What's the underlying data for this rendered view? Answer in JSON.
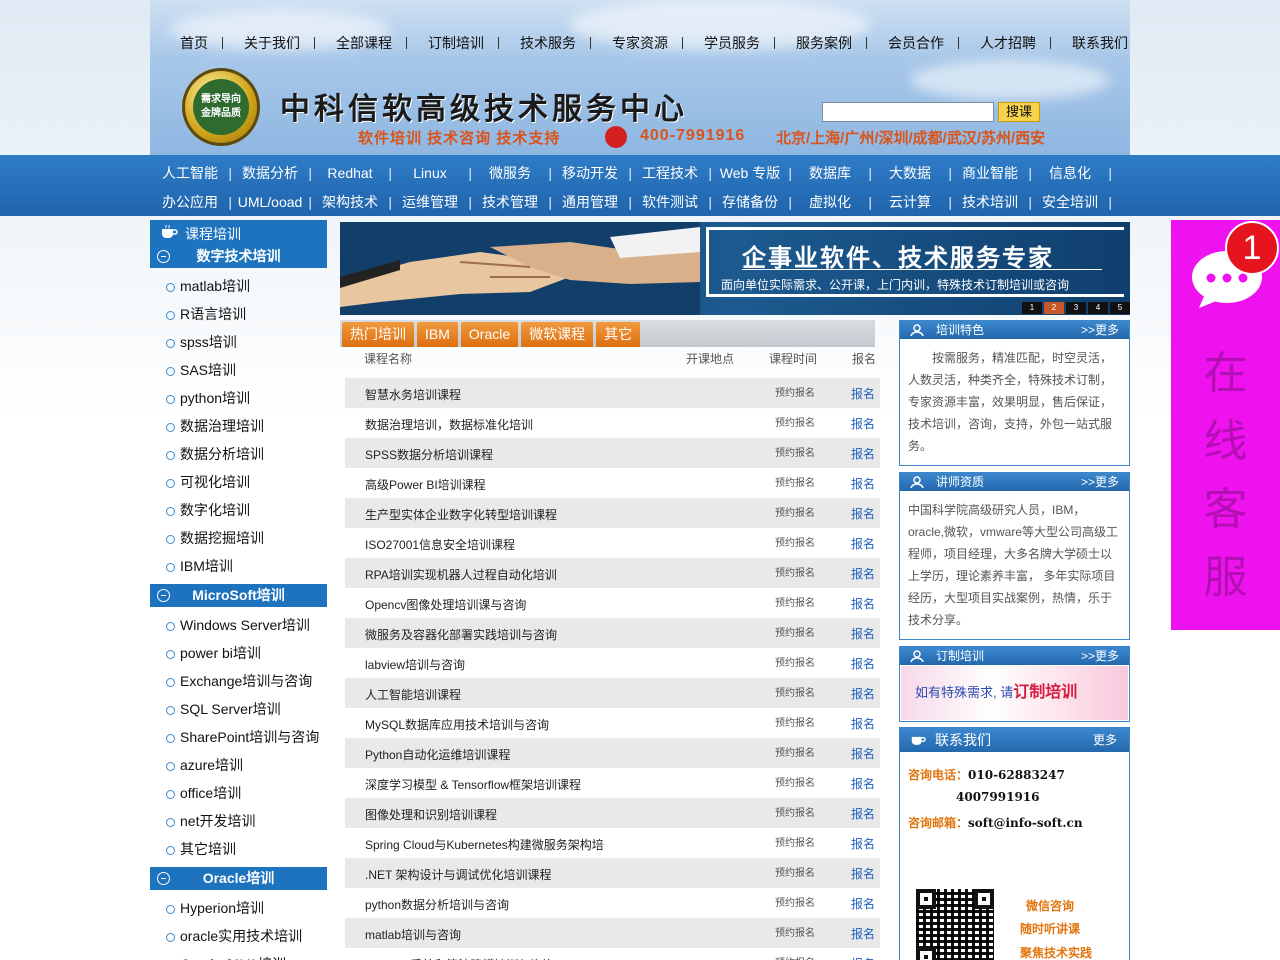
{
  "topnav": [
    "首页",
    "关于我们",
    "全部课程",
    "订制培训",
    "技术服务",
    "专家资源",
    "学员服务",
    "服务案例",
    "会员合作",
    "人才招聘",
    "联系我们"
  ],
  "header": {
    "seal_line1": "需求导向",
    "seal_line2": "金牌品质",
    "title": "中科信软高级技术服务中心",
    "slogan": "软件培训  技术咨询  技术支持",
    "phone": "400-7991916",
    "cities": "北京/上海/广州/深圳/成都/武汉/苏州/西安",
    "search_button": "搜课",
    "search_value": ""
  },
  "category_row1": [
    "人工智能",
    "数据分析",
    "Redhat",
    "Linux",
    "微服务",
    "移动开发",
    "工程技术",
    "Web 专版",
    "数据库",
    "大数据",
    "商业智能",
    "信息化"
  ],
  "category_row2": [
    "办公应用",
    "UML/ooad",
    "架构技术",
    "运维管理",
    "技术管理",
    "通用管理",
    "软件测试",
    "存储备份",
    "虚拟化",
    "云计算",
    "技术培训",
    "安全培训"
  ],
  "sidebar": {
    "header": "课程培训",
    "group1": "数字技术培训",
    "group1_items": [
      "matlab培训",
      "R语言培训",
      "spss培训",
      "SAS培训",
      "python培训",
      "数据治理培训",
      "数据分析培训",
      "可视化培训",
      "数字化培训",
      "数据挖掘培训",
      "IBM培训"
    ],
    "group2": "MicroSoft培训",
    "group2_items": [
      "Windows Server培训",
      "power bi培训",
      "Exchange培训与咨询",
      "SQL Server培训",
      "SharePoint培训与咨询",
      "azure培训",
      "office培训",
      "net开发培训",
      "其它培训"
    ],
    "group3": "Oracle培训",
    "group3_items": [
      "Hyperion培训",
      "oracle实用技术培训",
      "Oracle JAVA培训"
    ]
  },
  "banner": {
    "title": "企事业软件、技术服务专家",
    "subtitle": "面向单位实际需求、公开课，上门内训，特殊技术订制培训或咨询",
    "pages": [
      "1",
      "2",
      "3",
      "4",
      "5"
    ],
    "active_page": "2"
  },
  "tabs": [
    "热门培训",
    "IBM",
    "Oracle",
    "微软课程",
    "其它"
  ],
  "table": {
    "col_name": "课程名称",
    "col_location": "开课地点",
    "col_time": "课程时间",
    "col_signup": "报名",
    "time_text": "预约报名",
    "signup_text": "报名",
    "rows": [
      "智慧水务培训课程",
      "数据治理培训，数据标准化培训",
      "SPSS数据分析培训课程",
      "高级Power BI培训课程",
      "生产型实体企业数字化转型培训课程",
      "ISO27001信息安全培训课程",
      "RPA培训实现机器人过程自动化培训",
      "Opencv图像处理培训课与咨询",
      "微服务及容器化部署实践培训与咨询",
      "labview培训与咨询",
      "人工智能培训课程",
      "MySQL数据库应用技术培训与咨询",
      "Python自动化运维培训课程",
      "深度学习模型 & Tensorflow框架培训课程",
      "图像处理和识别培训课程",
      "Spring Cloud与Kubernetes构建微服务架构培",
      ".NET 架构设计与调试优化培训课程",
      "python数据分析培训与咨询",
      "matlab培训与咨询",
      "Simulink系统和算法建模培训与咨询"
    ]
  },
  "right": {
    "box1_title": "培训特色",
    "box1_more": ">>更多",
    "box1_text": "按需服务，精准匹配，时空灵活，人数灵活，种类齐全，特殊技术订制，专家资源丰富，效果明显，售后保证，技术培训，咨询，支持，外包一站式服务。",
    "box2_title": "讲师资质",
    "box2_more": ">>更多",
    "box2_text": "中国科学院高级研究人员，IBM，oracle,微软，vmware等大型公司高级工程师，项目经理，大多名牌大学硕士以上学历，理论素养丰富， 多年实际项目经历，大型项目实战案例，热情，乐于技术分享。",
    "box3_title": "订制培训",
    "box3_more": ">>更多",
    "box3_text_pre": "如有特殊需求, 请",
    "box3_text_em": "订制培训",
    "contact_title": "联系我们",
    "contact_more": "更多",
    "phone_label": "咨询电话：",
    "phone1": "010-62883247",
    "phone2": "4007991916",
    "email_label": "咨询邮箱：",
    "email": "soft@info-soft.cn",
    "wx1": "微信咨询",
    "wx2": "随时听讲课",
    "wx3": "聚焦技术实践"
  },
  "float_service": {
    "badge": "1",
    "text": [
      "在",
      "线",
      "客",
      "服"
    ]
  },
  "colors": {
    "brand_blue": "#1d73bd",
    "accent_orange": "#e27712",
    "float_magenta": "#ee12ee",
    "badge_red": "#e5141f"
  }
}
